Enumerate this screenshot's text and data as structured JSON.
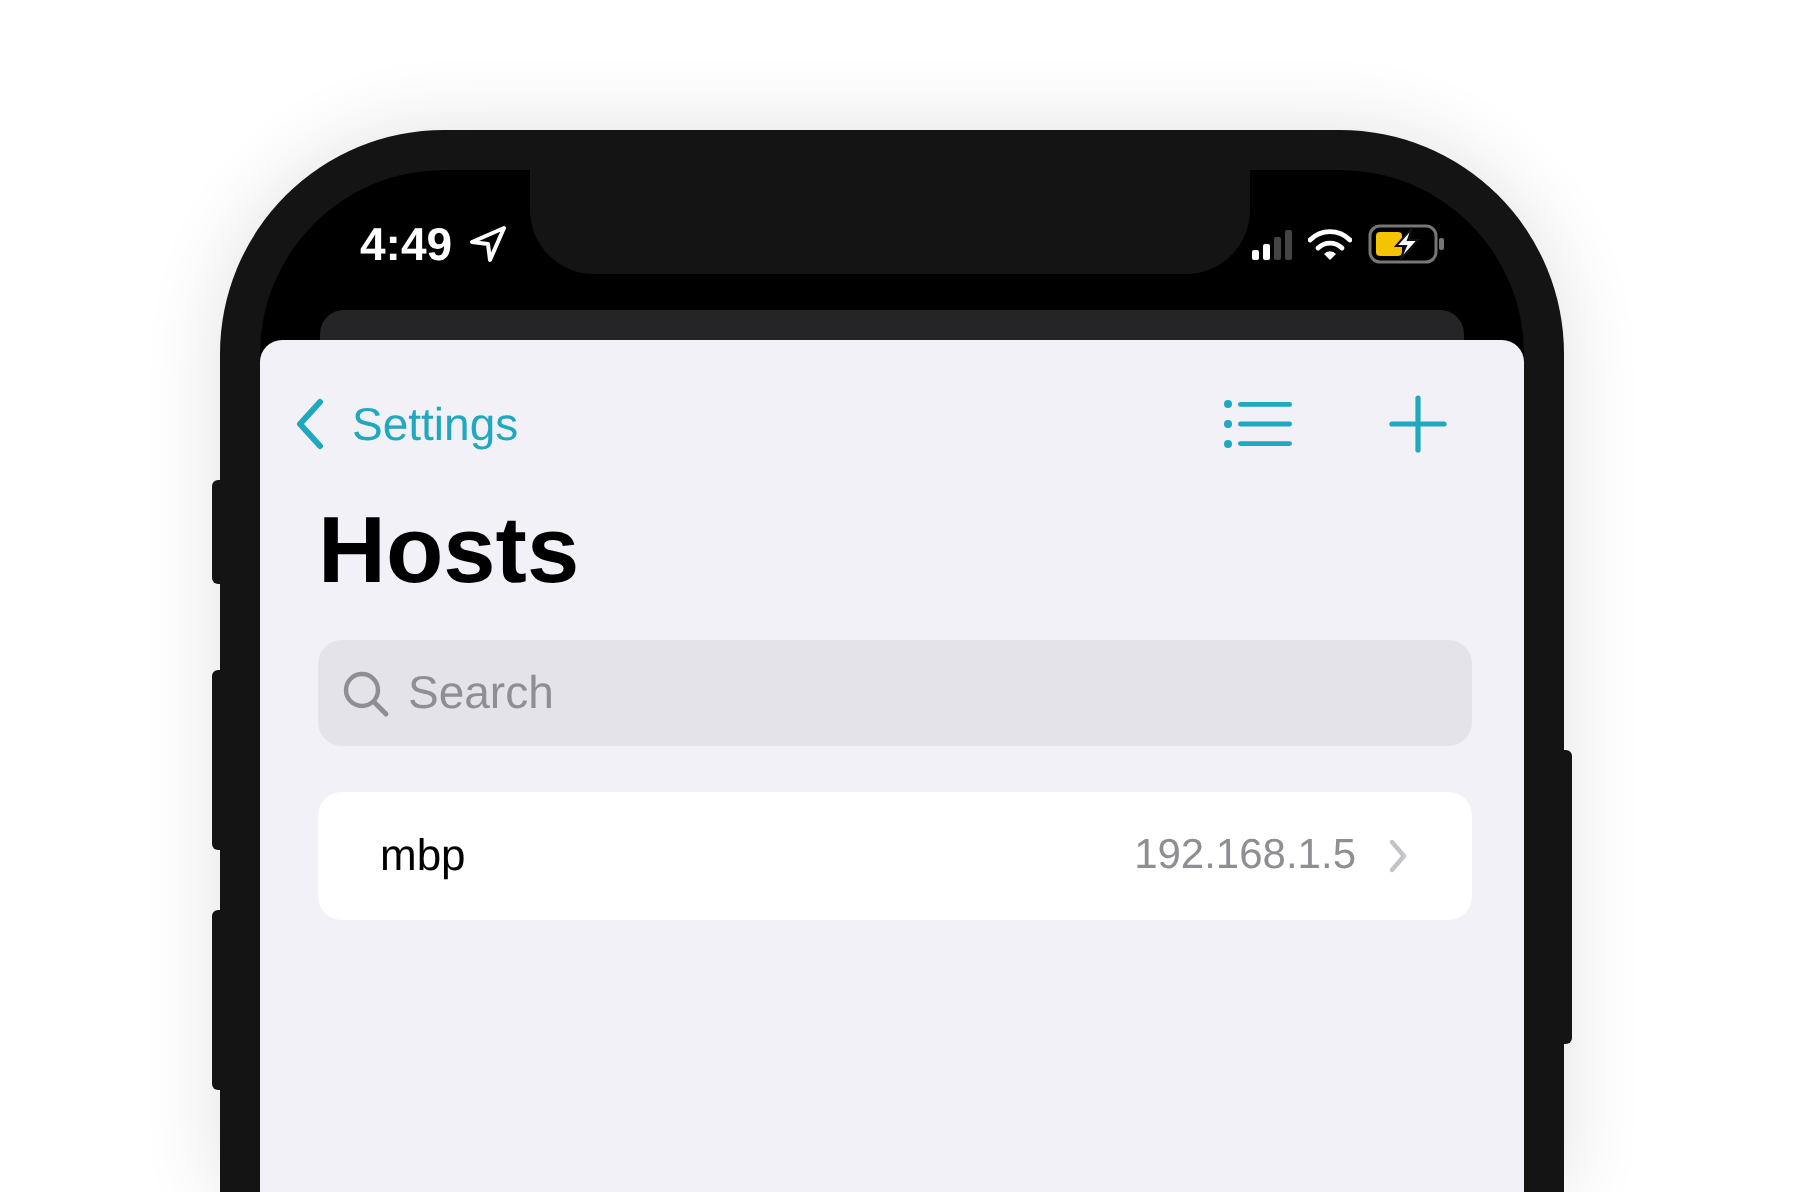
{
  "status_bar": {
    "time": "4:49"
  },
  "nav": {
    "back_label": "Settings"
  },
  "title": "Hosts",
  "search": {
    "placeholder": "Search"
  },
  "hosts": [
    {
      "name": "mbp",
      "address": "192.168.1.5"
    }
  ]
}
